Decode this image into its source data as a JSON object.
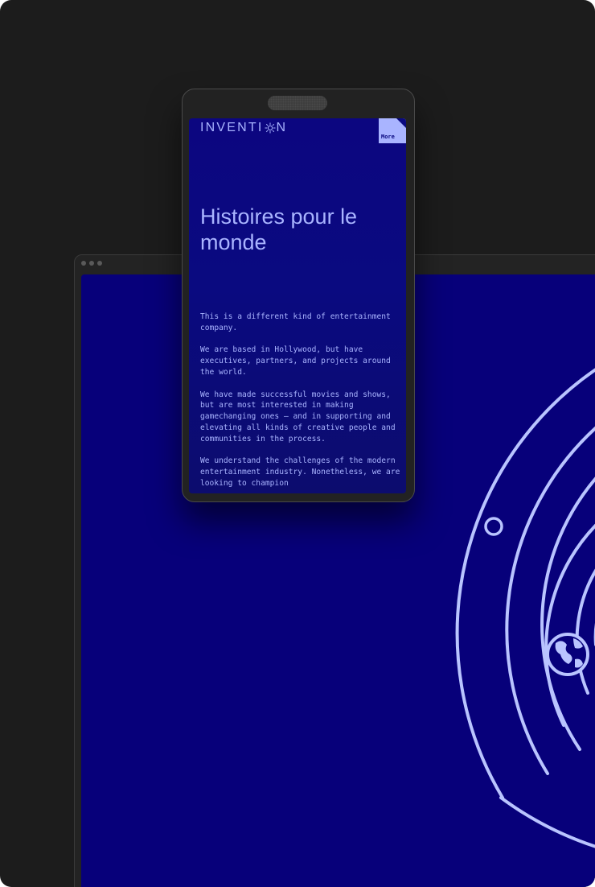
{
  "phone": {
    "logo": {
      "left": "INVENTI",
      "right": "N",
      "icon": "sun-icon"
    },
    "more_label": "More",
    "headline": "Histoires pour le monde",
    "paragraphs": [
      "This is a different kind of entertainment company.",
      "We are based in Hollywood, but have executives, partners, and projects around the world.",
      "We have made successful movies and shows, but are most interested in making gamechanging ones — and in supporting and elevating all kinds of creative people and communities in the process.",
      "We understand the challenges of the modern entertainment industry. Nonetheless, we are looking to champion"
    ]
  },
  "desktop": {
    "illustration": "orbits-with-planet-earth"
  },
  "colors": {
    "background": "#1c1c1c",
    "brand_blue": "#07007a",
    "accent_lavender": "#a9b4ff"
  }
}
